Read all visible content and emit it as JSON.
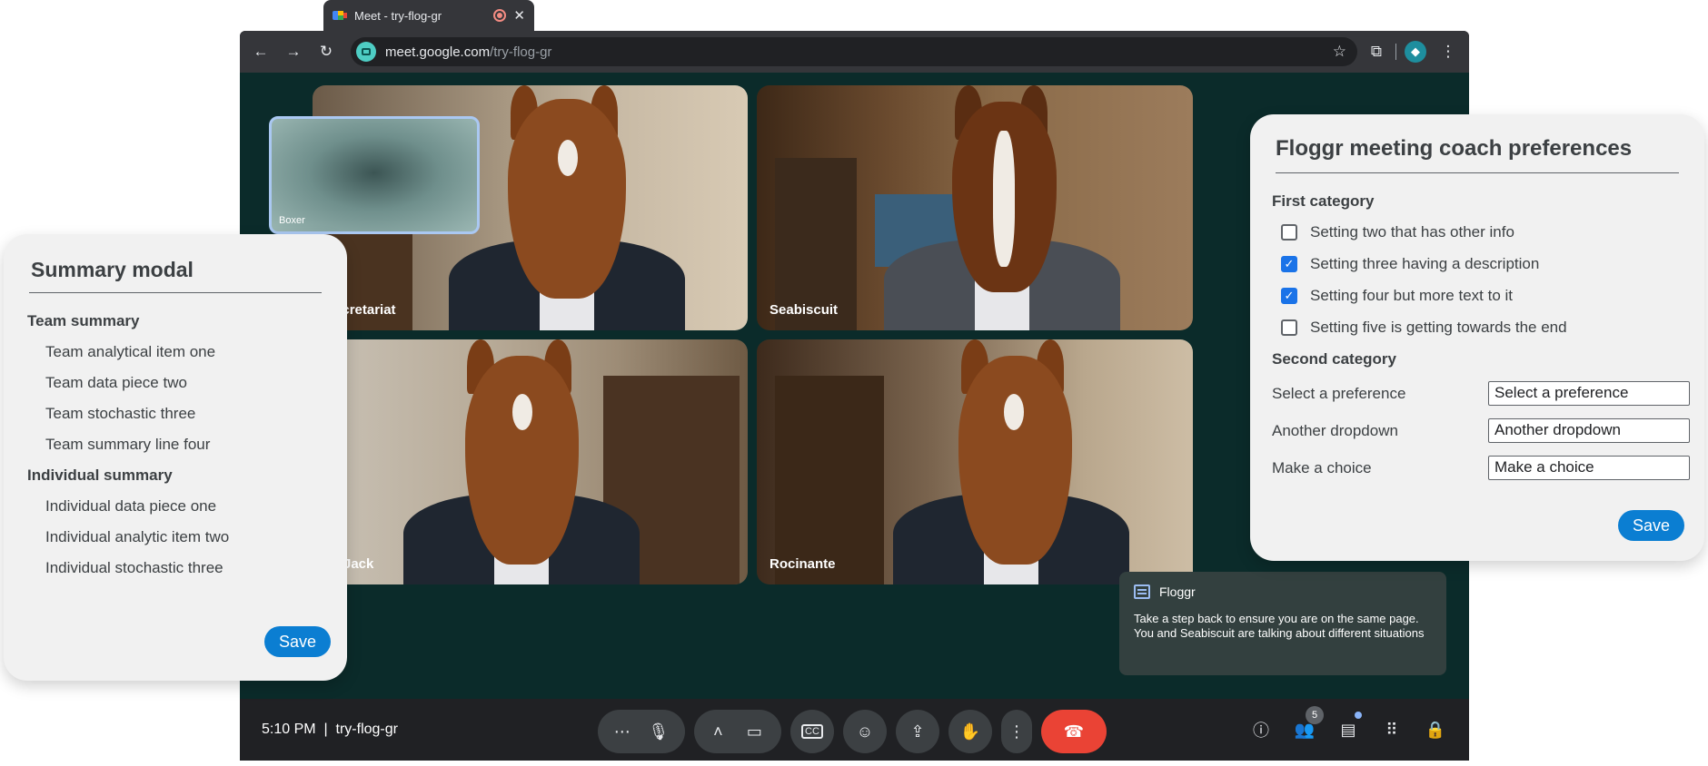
{
  "browser": {
    "tab_title": "Meet - try-flog-gr",
    "url_host": "meet.google.com",
    "url_path": "/try-flog-gr"
  },
  "meet": {
    "pip_name": "Boxer",
    "tiles": [
      {
        "name": "Secretariat"
      },
      {
        "name": "Seabiscuit"
      },
      {
        "name": "BoJack"
      },
      {
        "name": "Rocinante"
      }
    ],
    "notification": {
      "app": "Floggr",
      "message": "Take a step back to ensure you are on the same page. You and Seabiscuit are talking about different situations"
    },
    "time": "5:10 PM",
    "separator": "|",
    "meeting_code": "try-flog-gr",
    "participants_count": "5"
  },
  "summary_modal": {
    "title": "Summary modal",
    "team_heading": "Team summary",
    "team_items": [
      "Team analytical item one",
      "Team data piece two",
      "Team stochastic three",
      "Team summary line four"
    ],
    "individual_heading": "Individual summary",
    "individual_items": [
      "Individual data piece one",
      "Individual analytic item two",
      "Individual stochastic three"
    ],
    "save_label": "Save"
  },
  "prefs_modal": {
    "title": "Floggr meeting coach preferences",
    "first_category": "First category",
    "settings": [
      {
        "label": "Setting two that has other info",
        "checked": false
      },
      {
        "label": "Setting three having a description",
        "checked": true
      },
      {
        "label": "Setting four but more text to it",
        "checked": true
      },
      {
        "label": "Setting five is getting towards the end",
        "checked": false
      }
    ],
    "second_category": "Second category",
    "dropdowns": [
      {
        "label": "Select a preference",
        "value": "Select a preference"
      },
      {
        "label": "Another dropdown",
        "value": "Another dropdown"
      },
      {
        "label": "Make a choice",
        "value": "Make a choice"
      }
    ],
    "save_label": "Save"
  },
  "colors": {
    "accent": "#0b7ed2",
    "end_call": "#ea4335",
    "meet_bg": "#0b2b2a"
  }
}
